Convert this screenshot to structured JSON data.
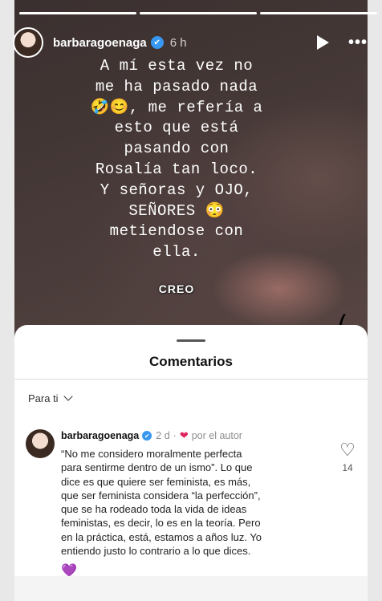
{
  "story": {
    "username": "barbaragoenaga",
    "verified_mark": "✔",
    "time": "6 h",
    "more_icon": "•••",
    "caption": "A mí esta vez no\nme ha pasado nada\n🤣😊, me refería a\nesto que está\npasando con\nRosalía tan loco.\nY señoras y OJO,\nSEÑORES 😳\nmetiendose con\nella.",
    "sticker": "CREO",
    "bracket": "("
  },
  "sheet": {
    "title": "Comentarios",
    "filter_label": "Para ti"
  },
  "comment": {
    "username": "barbaragoenaga",
    "verified_mark": "✔",
    "time": "2 d",
    "separator": "·",
    "heart_small": "❤",
    "author_liked": "por el autor",
    "text": "“No me considero moralmente perfecta\npara sentirme dentro de un ismo”. Lo que\ndice es que quiere ser feminista, es más,\nque ser feminista considera “la perfección”,\nque se ha rodeado toda la vida de ideas\nfeministas, es decir, lo es en la teoría. Pero\nen la práctica, está, estamos a años luz. Yo\nentiendo justo lo contrario a lo que dices.",
    "emoji": "💜",
    "like_icon": "♡",
    "like_count": "14"
  }
}
